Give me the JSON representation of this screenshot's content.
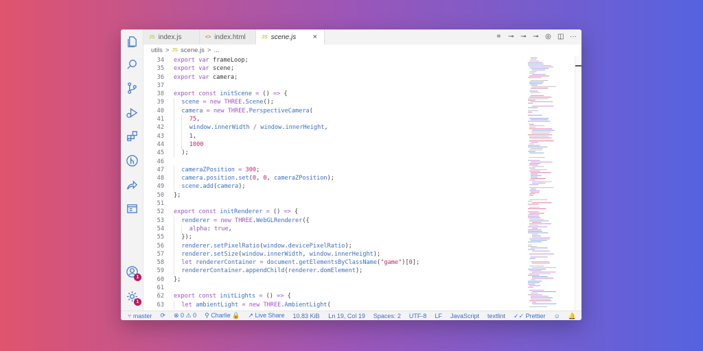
{
  "tabs": [
    {
      "icon": "JS",
      "label": "index.js"
    },
    {
      "icon": "<>",
      "label": "index.html"
    },
    {
      "icon": "JS",
      "label": "scene.js",
      "close": "×"
    }
  ],
  "breadcrumb": {
    "folder": "utils",
    "sep1": ">",
    "icon": "JS",
    "file": "scene.js",
    "sep2": ">",
    "more": "..."
  },
  "tab_actions": [
    "⌗",
    "⊸",
    "⊸",
    "⊸",
    "◎",
    "◫",
    "···"
  ],
  "code_lines": [
    {
      "n": "34",
      "indent": 0,
      "html": "<span class='kw'>export</span> <span class='kw'>var</span> <span class='var'>frameLoop</span>;"
    },
    {
      "n": "35",
      "indent": 0,
      "html": "<span class='kw'>export</span> <span class='kw'>var</span> <span class='var'>scene</span>;"
    },
    {
      "n": "36",
      "indent": 0,
      "html": "<span class='kw'>export</span> <span class='kw'>var</span> <span class='var'>camera</span>;"
    },
    {
      "n": "37",
      "indent": 0,
      "html": ""
    },
    {
      "n": "38",
      "indent": 0,
      "html": "<span class='kw'>export</span> <span class='kw'>const</span> <span class='fn'>initScene</span> <span class='op'>=</span> () <span class='op'>=&gt;</span> {"
    },
    {
      "n": "39",
      "indent": 1,
      "html": "<span class='fn'>scene</span> <span class='op'>=</span> <span class='kw'>new</span> <span class='kw'>THREE</span>.<span class='fn'>Scene</span>();"
    },
    {
      "n": "40",
      "indent": 1,
      "html": "<span class='fn'>camera</span> <span class='op'>=</span> <span class='kw'>new</span> <span class='kw'>THREE</span>.<span class='fn'>PerspectiveCamera</span>("
    },
    {
      "n": "41",
      "indent": 2,
      "html": "<span class='num'>75</span>,"
    },
    {
      "n": "42",
      "indent": 2,
      "html": "<span class='fn'>window</span>.<span class='fn'>innerWidth</span> <span class='op'>/</span> <span class='fn'>window</span>.<span class='fn'>innerHeight</span>,"
    },
    {
      "n": "43",
      "indent": 2,
      "html": "<span class='num'>1</span>,"
    },
    {
      "n": "44",
      "indent": 2,
      "html": "<span class='num'>1000</span>"
    },
    {
      "n": "45",
      "indent": 1,
      "html": ");"
    },
    {
      "n": "46",
      "indent": 0,
      "html": ""
    },
    {
      "n": "47",
      "indent": 1,
      "html": "<span class='fn'>cameraZPosition</span> <span class='op'>=</span> <span class='num'>300</span>;"
    },
    {
      "n": "48",
      "indent": 1,
      "html": "<span class='fn'>camera</span>.<span class='fn'>position</span>.<span class='fn'>set</span>(<span class='num'>0</span>, <span class='num'>0</span>, <span class='fn'>cameraZPosition</span>);"
    },
    {
      "n": "49",
      "indent": 1,
      "html": "<span class='fn'>scene</span>.<span class='fn'>add</span>(<span class='fn'>camera</span>);"
    },
    {
      "n": "50",
      "indent": 0,
      "html": "};"
    },
    {
      "n": "51",
      "indent": 0,
      "html": ""
    },
    {
      "n": "52",
      "indent": 0,
      "html": "<span class='kw'>export</span> <span class='kw'>const</span> <span class='fn'>initRenderer</span> <span class='op'>=</span> () <span class='op'>=&gt;</span> {"
    },
    {
      "n": "53",
      "indent": 1,
      "html": "<span class='fn'>renderer</span> <span class='op'>=</span> <span class='kw'>new</span> <span class='kw'>THREE</span>.<span class='fn'>WebGLRenderer</span>({"
    },
    {
      "n": "54",
      "indent": 2,
      "html": "<span class='kw'>alpha</span>: <span class='kw'>true</span>,"
    },
    {
      "n": "55",
      "indent": 1,
      "html": "});"
    },
    {
      "n": "56",
      "indent": 1,
      "html": "<span class='fn'>renderer</span>.<span class='fn'>setPixelRatio</span>(<span class='fn'>window</span>.<span class='fn'>devicePixelRatio</span>);"
    },
    {
      "n": "57",
      "indent": 1,
      "html": "<span class='fn'>renderer</span>.<span class='fn'>setSize</span>(<span class='fn'>window</span>.<span class='fn'>innerWidth</span>, <span class='fn'>window</span>.<span class='fn'>innerHeight</span>);"
    },
    {
      "n": "58",
      "indent": 1,
      "html": "<span class='kw'>let</span> <span class='fn'>rendererContainer</span> <span class='op'>=</span> <span class='fn'>document</span>.<span class='fn'>getElementsByClassName</span>(<span class='num'>\"game\"</span>)[<span class='num'>0</span>];"
    },
    {
      "n": "59",
      "indent": 1,
      "html": "<span class='fn'>rendererContainer</span>.<span class='fn'>appendChild</span>(<span class='fn'>renderer</span>.<span class='fn'>domElement</span>);"
    },
    {
      "n": "60",
      "indent": 0,
      "html": "};"
    },
    {
      "n": "61",
      "indent": 0,
      "html": ""
    },
    {
      "n": "62",
      "indent": 0,
      "html": "<span class='kw'>export</span> <span class='kw'>const</span> <span class='fn'>initLights</span> <span class='op'>=</span> () <span class='op'>=&gt;</span> {"
    },
    {
      "n": "63",
      "indent": 1,
      "html": "<span class='kw'>let</span> <span class='fn'>ambientLight</span> <span class='op'>=</span> <span class='kw'>new</span> <span class='kw'>THREE</span>.<span class='fn'>AmbientLight</span>("
    }
  ],
  "activity": [
    {
      "name": "explorer-icon"
    },
    {
      "name": "search-icon"
    },
    {
      "name": "source-control-icon"
    },
    {
      "name": "run-debug-icon"
    },
    {
      "name": "extensions-icon"
    },
    {
      "name": "git-graph-icon"
    },
    {
      "name": "live-share-icon"
    },
    {
      "name": "browser-preview-icon"
    }
  ],
  "account_badge": "1",
  "settings_badge": "1",
  "status": {
    "branch": "master",
    "sync": "⟳",
    "problems": "⊗ 0 ⚠ 0",
    "user": "Charlie",
    "live_share": "Live Share",
    "size": "10.83 KiB",
    "position": "Ln 19, Col 19",
    "spaces": "Spaces: 2",
    "encoding": "UTF-8",
    "eol": "LF",
    "language": "JavaScript",
    "linter": "textlint",
    "formatter": "✓✓ Prettier",
    "feedback": "☺",
    "bell": "🔔"
  },
  "colors": {
    "accent": "#3a6fd8",
    "keyword": "#a352d1",
    "number": "#d5236a",
    "badge": "#c1185b"
  }
}
